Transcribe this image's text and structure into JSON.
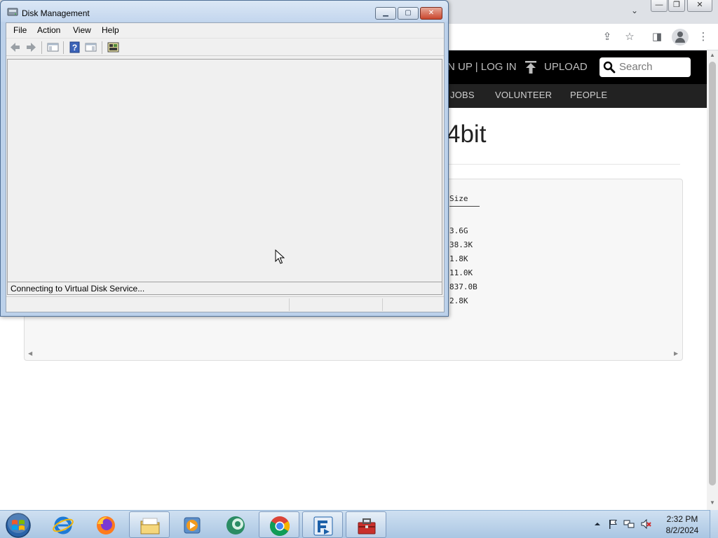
{
  "browser": {
    "window_controls": {
      "minimize": "—",
      "restore": "❐",
      "close": "✕"
    },
    "tab_menu_glyph": "⌄",
    "tools": {
      "share": "⇪",
      "bookmark": "☆",
      "sidepanel": "◨",
      "menu": "⋮"
    },
    "site": {
      "header": {
        "account_links": "N UP | LOG IN",
        "upload": "UPLOAD",
        "search_placeholder": "Search"
      },
      "nav": [
        "JOBS",
        "VOLUNTEER",
        "PEOPLE"
      ],
      "page_title": "4bit",
      "files": {
        "column_header": "Size",
        "sizes": [
          "3.6G",
          "38.3K",
          "1.8K",
          "11.0K",
          "837.0B",
          "2.8K"
        ]
      }
    }
  },
  "disk_management": {
    "title": "Disk Management",
    "menu": [
      "File",
      "Action",
      "View",
      "Help"
    ],
    "status_text": "Connecting to Virtual Disk Service...",
    "buttons": {
      "minimize": "▁",
      "maximize": "▢",
      "close": "✕"
    },
    "toolbar_icons": [
      "back-arrow-icon",
      "forward-arrow-icon",
      "console-tree-icon",
      "help-icon",
      "action-pane-icon",
      "disk-properties-icon"
    ]
  },
  "taskbar": {
    "pinned": [
      "internet-explorer-icon",
      "firefox-icon",
      "file-explorer-icon",
      "media-player-icon",
      "app-green-icon",
      "chrome-icon",
      "filezilla-icon",
      "toolbox-icon"
    ],
    "clock": {
      "time": "2:32 PM",
      "date": "8/2/2024"
    },
    "tray": [
      "show-hidden-icons",
      "flag-icon",
      "network-icon",
      "volume-muted-icon"
    ],
    "colors": {
      "taskbar": "#aac6e3",
      "titlebar": "#c3d6ee"
    }
  }
}
